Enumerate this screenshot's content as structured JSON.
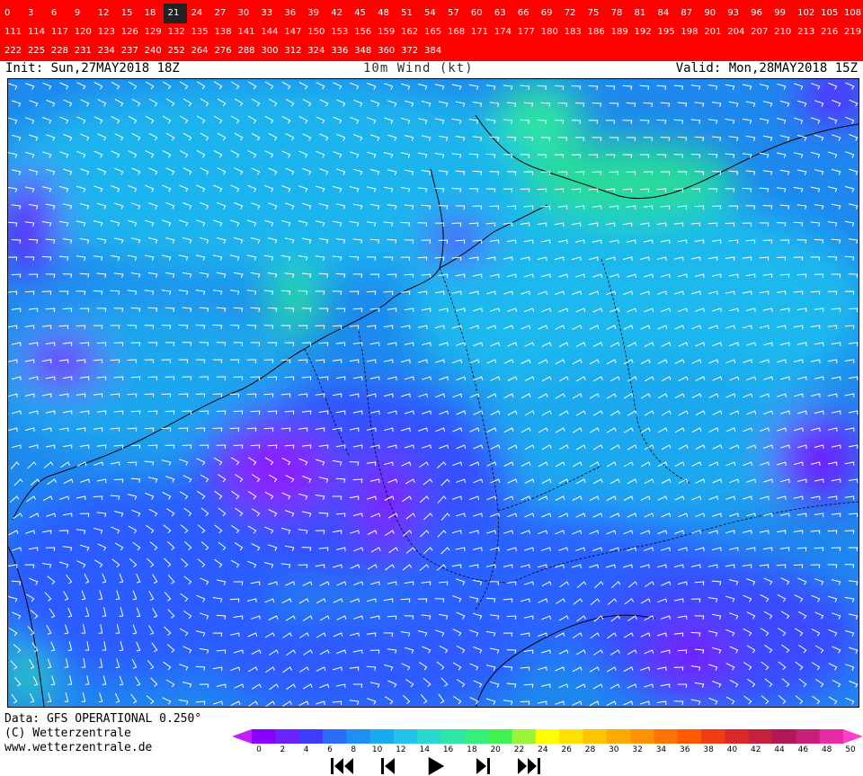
{
  "forecast_hours": [
    [
      "0",
      "3",
      "6",
      "9",
      "12",
      "15",
      "18",
      "21",
      "24",
      "27",
      "30",
      "33",
      "36",
      "39",
      "42",
      "45",
      "48",
      "51",
      "54",
      "57",
      "60",
      "63",
      "66",
      "69",
      "72",
      "75",
      "78",
      "81",
      "84",
      "87",
      "90",
      "93",
      "96",
      "99",
      "102",
      "105",
      "108"
    ],
    [
      "111",
      "114",
      "117",
      "120",
      "123",
      "126",
      "129",
      "132",
      "135",
      "138",
      "141",
      "144",
      "147",
      "150",
      "153",
      "156",
      "159",
      "162",
      "165",
      "168",
      "171",
      "174",
      "177",
      "180",
      "183",
      "186",
      "189",
      "192",
      "195",
      "198",
      "201",
      "204",
      "207",
      "210",
      "213",
      "216",
      "219"
    ],
    [
      "222",
      "225",
      "228",
      "231",
      "234",
      "237",
      "240",
      "252",
      "264",
      "276",
      "288",
      "300",
      "312",
      "324",
      "336",
      "348",
      "360",
      "372",
      "384"
    ]
  ],
  "selected_hour": "21",
  "header": {
    "init": "Init: Sun,27MAY2018 18Z",
    "title": "10m Wind (kt)",
    "valid": "Valid: Mon,28MAY2018 15Z"
  },
  "credits": {
    "data": "Data: GFS OPERATIONAL 0.250°",
    "copyright": "(C) Wetterzentrale",
    "url": "www.wetterzentrale.de"
  },
  "legend": {
    "ticks": [
      "0",
      "2",
      "4",
      "6",
      "8",
      "10",
      "12",
      "14",
      "16",
      "18",
      "20",
      "22",
      "24",
      "26",
      "28",
      "30",
      "32",
      "34",
      "36",
      "38",
      "40",
      "42",
      "44",
      "46",
      "48",
      "50"
    ],
    "colors": [
      "#8a00ff",
      "#6a22ff",
      "#3d3dff",
      "#2a6cff",
      "#1d8ff5",
      "#1aaaf0",
      "#22c4ee",
      "#2ad8d0",
      "#2ee6a8",
      "#34ef7c",
      "#3ff252",
      "#9af53a",
      "#ffff00",
      "#ffe000",
      "#ffc400",
      "#ffa800",
      "#ff9000",
      "#ff7400",
      "#ff5a00",
      "#f03c14",
      "#d82828",
      "#c42040",
      "#b01858",
      "#c8207a",
      "#e82aa8"
    ]
  },
  "controls": {
    "first": "first-frame",
    "prev": "previous-frame",
    "play": "play",
    "next": "next-frame",
    "last": "last-frame"
  },
  "colors": {
    "selector_bg": "#ff0000",
    "selector_active": "#222222",
    "barb": "#ffffff",
    "border": "#000000"
  }
}
